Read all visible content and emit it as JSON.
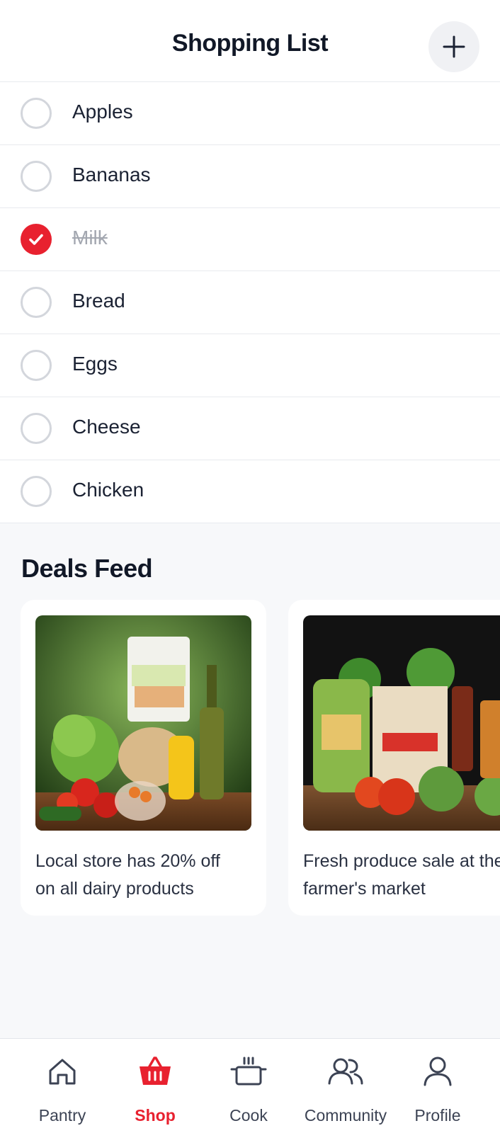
{
  "header": {
    "title": "Shopping List",
    "add_icon": "plus-icon"
  },
  "shopping_list": {
    "items": [
      {
        "label": "Apples",
        "checked": false
      },
      {
        "label": "Bananas",
        "checked": false
      },
      {
        "label": "Milk",
        "checked": true
      },
      {
        "label": "Bread",
        "checked": false
      },
      {
        "label": "Eggs",
        "checked": false
      },
      {
        "label": "Cheese",
        "checked": false
      },
      {
        "label": "Chicken",
        "checked": false
      }
    ]
  },
  "deals": {
    "title": "Deals Feed",
    "cards": [
      {
        "text": "Local store has 20% off\non all dairy products"
      },
      {
        "text": "Fresh produce sale at the\nfarmer's market"
      }
    ]
  },
  "nav": {
    "items": [
      {
        "label": "Pantry",
        "icon": "home-icon",
        "active": false
      },
      {
        "label": "Shop",
        "icon": "basket-icon",
        "active": true
      },
      {
        "label": "Cook",
        "icon": "pot-icon",
        "active": false
      },
      {
        "label": "Community",
        "icon": "users-icon",
        "active": false
      },
      {
        "label": "Profile",
        "icon": "user-icon",
        "active": false
      }
    ]
  },
  "colors": {
    "accent": "#e8212f",
    "text_primary": "#111827",
    "text_muted": "#a3a7b0",
    "background": "#f7f8fa",
    "divider": "#e8eaee"
  }
}
